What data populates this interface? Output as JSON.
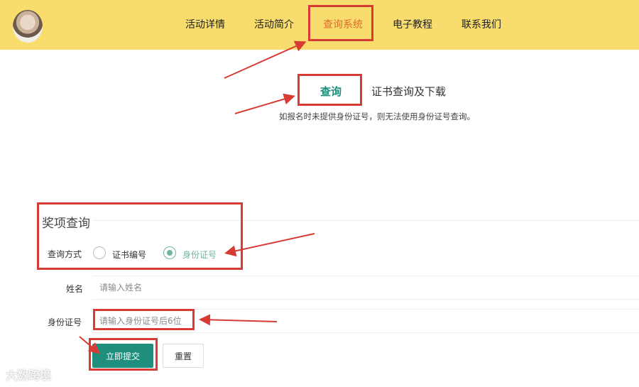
{
  "nav": {
    "items": [
      {
        "label": "活动详情"
      },
      {
        "label": "活动简介"
      },
      {
        "label": "查询系统"
      },
      {
        "label": "电子教程"
      },
      {
        "label": "联系我们"
      }
    ]
  },
  "query": {
    "tab": "查询",
    "subtitle": "证书查询及下载",
    "note": "如报名时未提供身份证号，则无法使用身份证号查询。"
  },
  "award": {
    "title": "奖项查询",
    "mode_label": "查询方式",
    "options": [
      {
        "label": "证书编号",
        "checked": false
      },
      {
        "label": "身份证号",
        "checked": true
      }
    ],
    "name_label": "姓名",
    "name_placeholder": "请输入姓名",
    "id_label": "身份证号",
    "id_placeholder": "请输入身份证号后6位",
    "submit": "立即提交",
    "reset": "重置"
  },
  "watermark": "大数跨境",
  "colors": {
    "header": "#f8dc6d",
    "accent": "#1e8f7d",
    "active_nav": "#e06a2a",
    "annotation": "#d63b34"
  }
}
